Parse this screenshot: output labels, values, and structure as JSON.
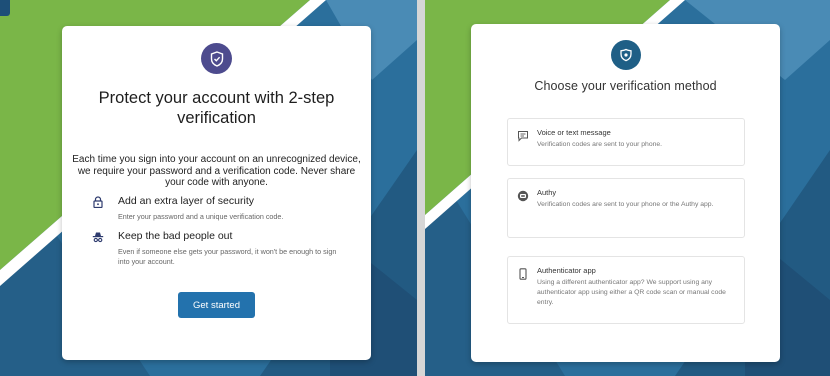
{
  "colors": {
    "background_blue": "#2b6f9c",
    "accent_green": "#7ab648",
    "badge_left": "#4d4b8e",
    "badge_right": "#1f5f86",
    "primary_button": "#2372ad"
  },
  "left_screen": {
    "badge_icon": "shield-check-icon",
    "title": "Protect your account with 2-step verification",
    "intro": "Each time you sign into your account on an unrecognized device, we require your password and a verification code. Never share your code with anyone.",
    "benefits": [
      {
        "icon": "lock-icon",
        "title": "Add an extra layer of security",
        "description": "Enter your password and a unique verification code."
      },
      {
        "icon": "incognito-icon",
        "title": "Keep the bad people out",
        "description": "Even if someone else gets your password, it won't be enough to sign into your account."
      }
    ],
    "get_started_label": "Get started"
  },
  "right_screen": {
    "badge_icon": "shield-icon",
    "title": "Choose your verification method",
    "methods": [
      {
        "icon": "chat-icon",
        "title": "Voice or text message",
        "description": "Verification codes are sent to your phone."
      },
      {
        "icon": "authy-icon",
        "title": "Authy",
        "description": "Verification codes are sent to your phone or the Authy app."
      },
      {
        "icon": "phone-icon",
        "title": "Authenticator app",
        "description": "Using a different authenticator app? We support using any authenticator app using either a QR code scan or manual code entry."
      }
    ]
  }
}
